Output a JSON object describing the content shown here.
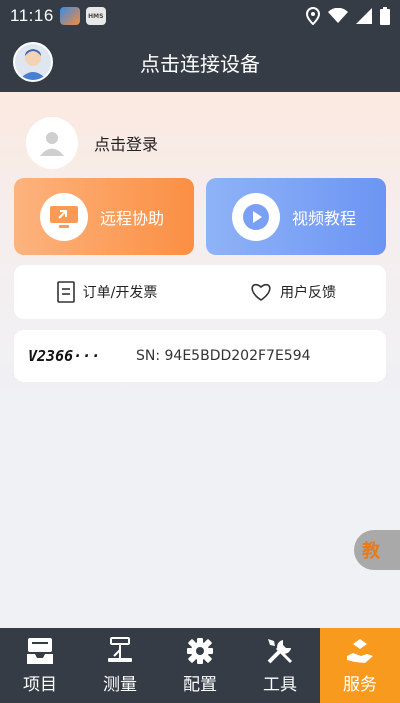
{
  "status_bar": {
    "time": "11:16",
    "badge_b_text": "HMS"
  },
  "header": {
    "title": "点击连接设备"
  },
  "login": {
    "label": "点击登录"
  },
  "cards": {
    "remote_label": "远程协助",
    "video_label": "视频教程"
  },
  "links": {
    "order_label": "订单/开发票",
    "feedback_label": "用户反馈"
  },
  "device": {
    "name": "V2366···",
    "sn": "SN: 94E5BDD202F7E594"
  },
  "float_button": {
    "label": "教"
  },
  "nav": {
    "items": [
      {
        "label": "项目",
        "icon": "project-icon"
      },
      {
        "label": "测量",
        "icon": "measure-icon"
      },
      {
        "label": "配置",
        "icon": "settings-icon"
      },
      {
        "label": "工具",
        "icon": "tools-icon"
      },
      {
        "label": "服务",
        "icon": "service-icon"
      }
    ],
    "active_index": 4
  },
  "colors": {
    "dark": "#353c45",
    "accent": "#f79a1e",
    "remote": "#fb8f43",
    "video": "#6c95f3"
  }
}
